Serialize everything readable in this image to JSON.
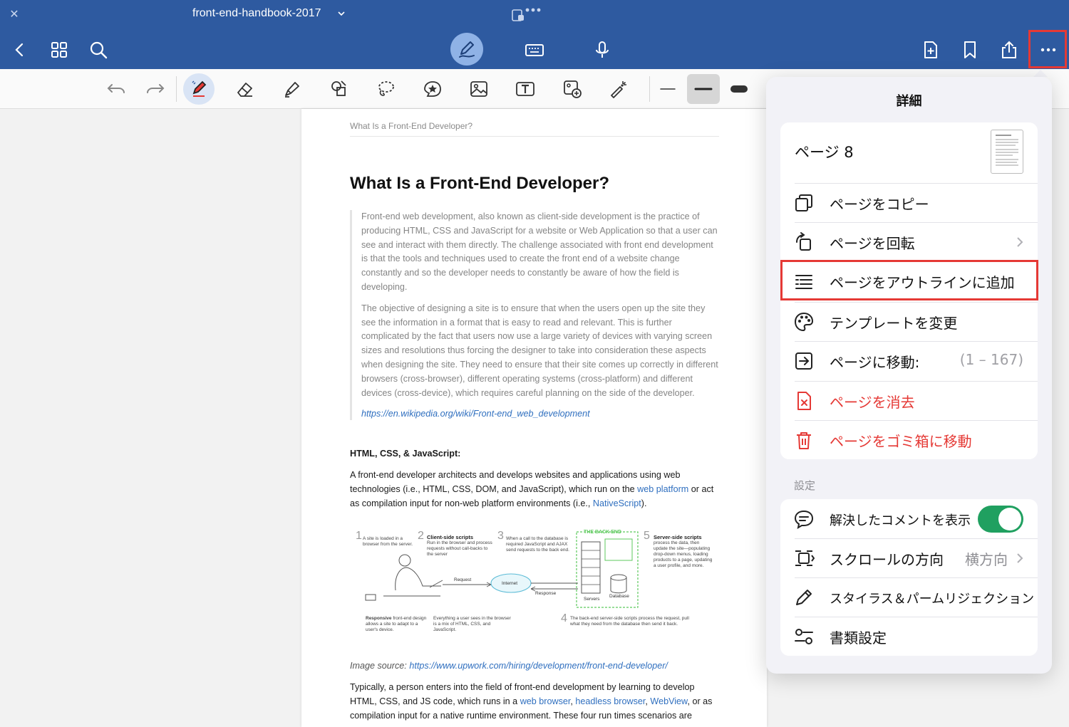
{
  "titlebar": {
    "title": "front-end-handbook-2017"
  },
  "toolbar": {
    "stroke_widths": [
      "thin",
      "medium",
      "thick"
    ],
    "selected_stroke": "medium"
  },
  "colors": {
    "chrome": "#2e5aa0",
    "accent_red": "#e53935",
    "toggle_on": "#20a060",
    "link": "#2f6fbf"
  },
  "document": {
    "running_head": "What Is a Front-End Developer?",
    "heading": "What Is a Front-End Developer?",
    "quote_p1": "Front-end web development, also known as client-side development is the practice of producing HTML, CSS and JavaScript for a website or Web Application so that a user can see and interact with them directly. The challenge associated with front end development is that the tools and techniques used to create the front end of a website change constantly and so the developer needs to constantly be aware of how the field is developing.",
    "quote_p2": "The objective of designing a site is to ensure that when the users open up the site they see the information in a format that is easy to read and relevant. This is further complicated by the fact that users now use a large variety of devices with varying screen sizes and resolutions thus forcing the designer to take into consideration these aspects when designing the site. They need to ensure that their site comes up correctly in different browsers (cross-browser), different operating systems (cross-platform) and different devices (cross-device), which requires careful planning on the side of the developer.",
    "quote_link": "https://en.wikipedia.org/wiki/Front-end_web_development",
    "section_title": "HTML, CSS, & JavaScript:",
    "section_p1_a": "A front-end developer architects and develops websites and applications using web technologies (i.e., HTML, CSS, DOM, and JavaScript), which run on the ",
    "section_p1_link1": "web platform",
    "section_p1_b": " or act as compilation input for non-web platform environments (i.e., ",
    "section_p1_link2": "NativeScript",
    "section_p1_c": ").",
    "figure": {
      "n1": "1",
      "t1": "A site is loaded in a browser from the server.",
      "n2": "2",
      "h2": "Client-side scripts",
      "t2": "Run in the browser and process requests without call-backs to the server",
      "n3": "3",
      "t3": "When a call to the database is required JavaScript and AJAX send requests to the back end.",
      "backend": "THE BACK END",
      "n5": "5",
      "h5": "Server-side scripts",
      "t5": "process the data, then update the site—populating drop-down menus, loading products to a page, updating a user profile, and more.",
      "request": "Request",
      "response": "Response",
      "internet": "Internet",
      "servers": "Servers",
      "database": "Database",
      "responsive_b": "Responsive",
      "responsive": "front-end design allows a site to adapt to a user's device.",
      "everything": "Everything a user sees in the browser is a mix of HTML, CSS, and JavaScript.",
      "n4": "4",
      "t4": "The back-end server-side scripts process the request, pull what they need from the database then send it back."
    },
    "caption_prefix": "Image source: ",
    "caption_link": "https://www.upwork.com/hiring/development/front-end-developer/",
    "p2_a": "Typically, a person enters into the field of front-end development by learning to develop HTML, CSS, and JS code, which runs in a ",
    "p2_link1": "web browser",
    "p2_sep1": ", ",
    "p2_link2": "headless browser",
    "p2_sep2": ", ",
    "p2_link3": "WebView",
    "p2_b": ", or as compilation input for a native runtime environment. These four run times scenarios are"
  },
  "popover": {
    "title": "詳細",
    "page_label": "ページ 8",
    "items": [
      {
        "label": "ページをコピー",
        "icon": "copy-icon"
      },
      {
        "label": "ページを回転",
        "icon": "rotate-icon"
      },
      {
        "label": "ページをアウトラインに追加",
        "icon": "outline-icon"
      },
      {
        "label": "テンプレートを変更",
        "icon": "palette-icon"
      },
      {
        "label": "ページに移動:",
        "icon": "goto-icon",
        "value": "(1 – 167)"
      },
      {
        "label": "ページを消去",
        "icon": "clear-page-icon"
      },
      {
        "label": "ページをゴミ箱に移動",
        "icon": "trash-icon"
      }
    ],
    "settings_label": "設定",
    "settings": [
      {
        "label": "解決したコメントを表示",
        "icon": "comment-icon",
        "toggle": true
      },
      {
        "label": "スクロールの方向",
        "icon": "scroll-direction-icon",
        "value": "横方向"
      },
      {
        "label": "スタイラス＆パームリジェクション",
        "icon": "stylus-icon"
      },
      {
        "label": "書類設定",
        "icon": "document-settings-icon"
      }
    ]
  }
}
